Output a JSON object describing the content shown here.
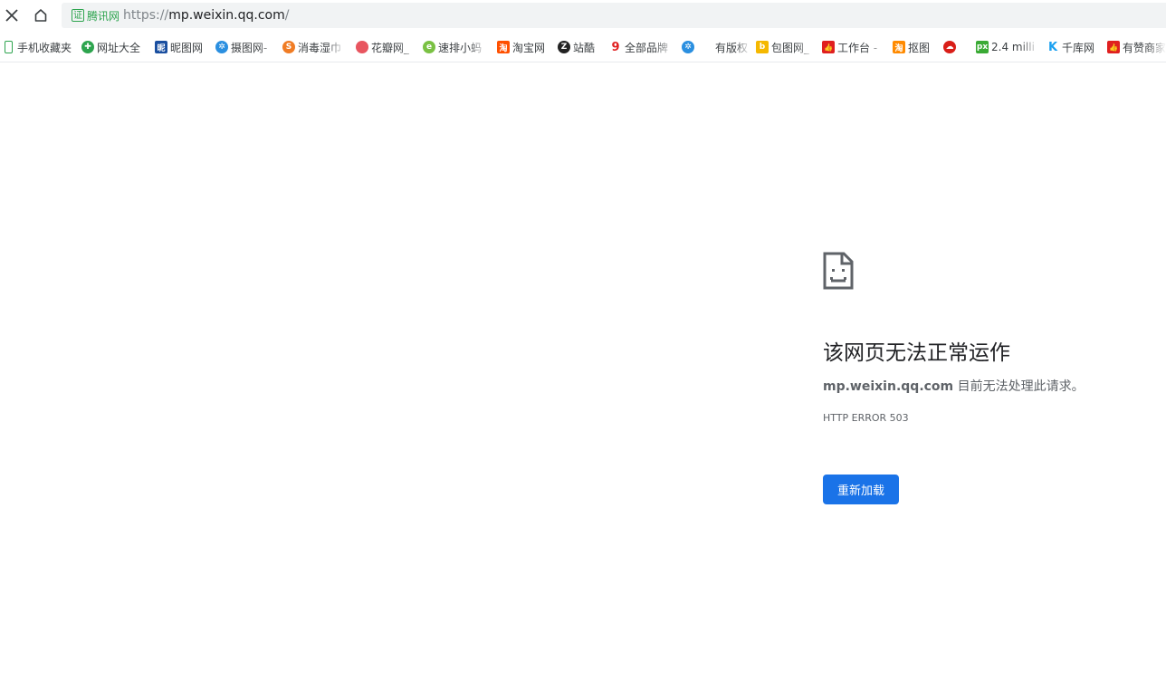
{
  "toolbar": {
    "stop_icon": "close-icon",
    "home_icon": "home-icon"
  },
  "address": {
    "cert_char": "证",
    "cert_label": "腾讯网",
    "scheme": "https://",
    "host": "mp.weixin.qq.com",
    "path": "/"
  },
  "bookmarks": [
    {
      "label": "手机收藏夹",
      "icon": "phone-icon",
      "color": "#2da44e",
      "glyph": ""
    },
    {
      "label": "网址大全",
      "icon": "star-icon",
      "color": "#2da44e",
      "glyph": "✚"
    },
    {
      "label": "昵图网",
      "icon": "nipic-icon",
      "color": "#1a4fa0",
      "glyph": "昵"
    },
    {
      "label": "摄图网-",
      "icon": "camera-icon",
      "color": "#2a8fe0",
      "glyph": "✲"
    },
    {
      "label": "消毒湿巾",
      "icon": "sogou-icon",
      "color": "#f07c24",
      "glyph": "S"
    },
    {
      "label": "花瓣网_",
      "icon": "huaban-icon",
      "color": "#e8555f",
      "glyph": ""
    },
    {
      "label": "速排小蚂",
      "icon": "supai-icon",
      "color": "#7ac143",
      "glyph": "e"
    },
    {
      "label": "淘宝网",
      "icon": "taobao-icon",
      "color": "#ff5000",
      "glyph": "淘"
    },
    {
      "label": "站酷",
      "icon": "zcool-icon",
      "color": "#222222",
      "glyph": "Z"
    },
    {
      "label": "全部品牌",
      "icon": "jiu-icon",
      "color": "#e02020",
      "glyph": "9"
    },
    {
      "label": "",
      "icon": "camera-icon",
      "color": "#2a8fe0",
      "glyph": "✲"
    },
    {
      "label": "有版权",
      "icon": "blank-icon",
      "color": "#ffffff",
      "glyph": ""
    },
    {
      "label": "包图网_",
      "icon": "baotu-icon",
      "color": "#f5b800",
      "glyph": "b"
    },
    {
      "label": "工作台 -",
      "icon": "thumbs-up-icon",
      "color": "#e02020",
      "glyph": "👍"
    },
    {
      "label": "抠图",
      "icon": "koutu-icon",
      "color": "#ff8a00",
      "glyph": "淘"
    },
    {
      "label": "",
      "icon": "cloud-icon",
      "color": "#d91e18",
      "glyph": "☁"
    },
    {
      "label": "2.4 milli",
      "icon": "px-icon",
      "color": "#3aaa35",
      "glyph": "px"
    },
    {
      "label": "千库网",
      "icon": "qianku-icon",
      "color": "#1aa0f0",
      "glyph": "K"
    },
    {
      "label": "有赞商家",
      "icon": "thumbs-up-icon",
      "color": "#e02020",
      "glyph": "👍"
    }
  ],
  "error": {
    "icon": "sad-page-icon",
    "title": "该网页无法正常运作",
    "host": "mp.weixin.qq.com",
    "message": " 目前无法处理此请求。",
    "code": "HTTP ERROR 503",
    "reload_label": "重新加载"
  }
}
